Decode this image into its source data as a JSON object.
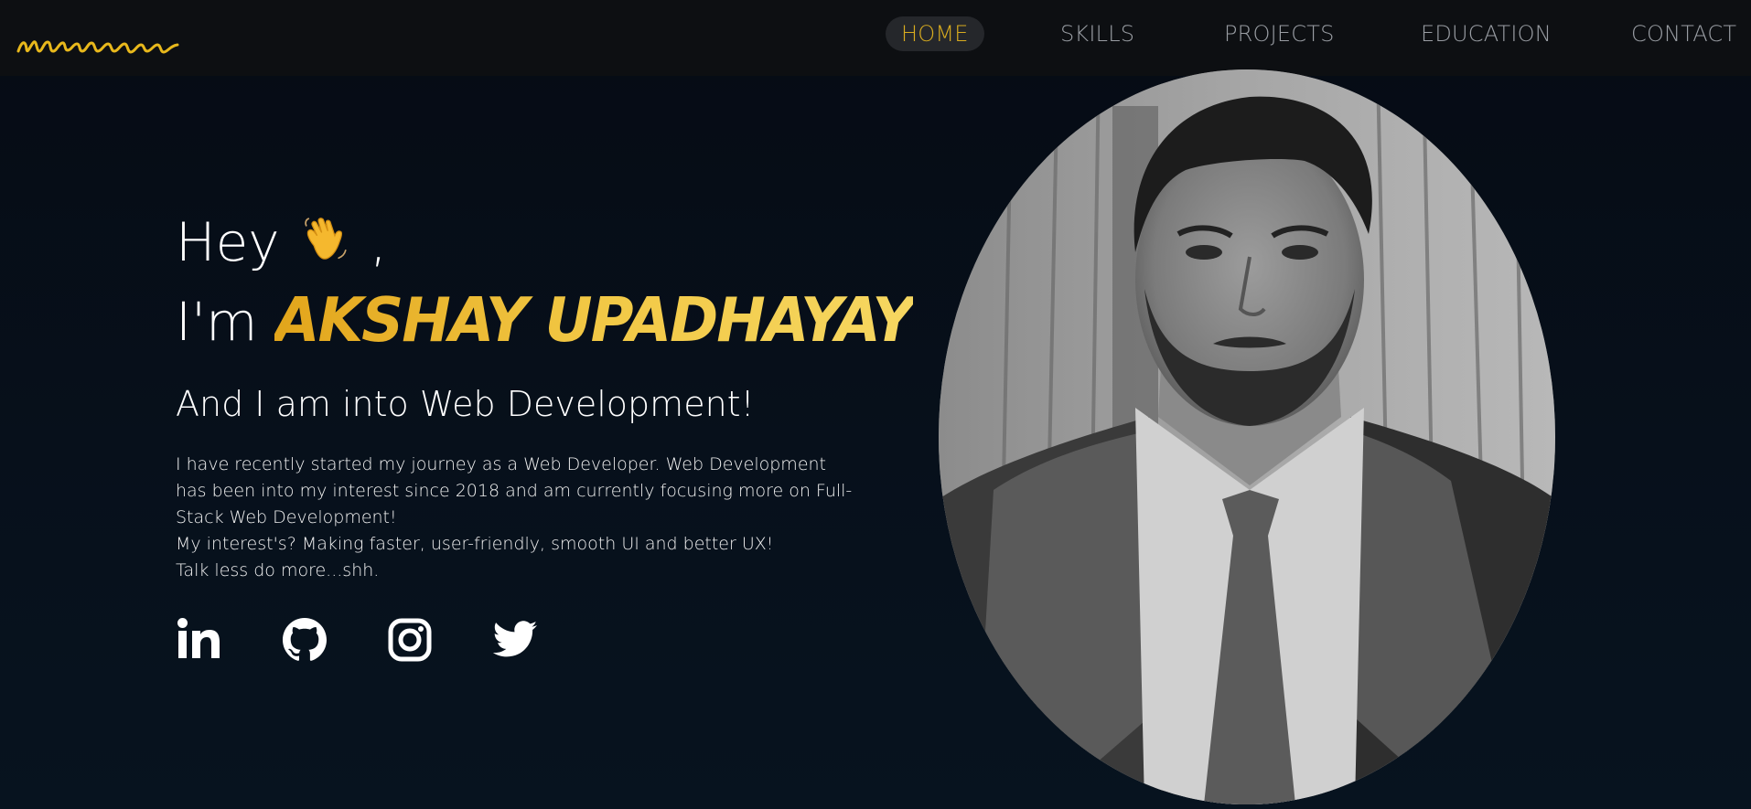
{
  "nav": {
    "items": [
      {
        "label": "HOME",
        "active": true
      },
      {
        "label": "SKILLS",
        "active": false
      },
      {
        "label": "PROJECTS",
        "active": false
      },
      {
        "label": "EDUCATION",
        "active": false
      },
      {
        "label": "CONTACT",
        "active": false
      }
    ]
  },
  "hero": {
    "greeting": "Hey",
    "greeting_suffix": ",",
    "im": "I'm",
    "name": "AKSHAY UPADHAYAY",
    "subtitle": "And I am into Web Development!",
    "about_lines": [
      "I have recently started my journey as a Web Developer. Web Development has been into my interest since 2018 and am currently focusing more on Full-Stack Web Development!",
      "My interest's? Making faster, user-friendly, smooth UI and better UX!",
      "Talk less do more...shh."
    ]
  },
  "socials": [
    {
      "icon": "linkedin-icon"
    },
    {
      "icon": "github-icon"
    },
    {
      "icon": "instagram-icon"
    },
    {
      "icon": "twitter-icon"
    }
  ],
  "colors": {
    "accent": "#d9ac1f",
    "name_gradient_start": "#e2a51b",
    "name_gradient_end": "#f6d761",
    "nav_bg": "#0d0f12",
    "page_bg": "#07101b"
  }
}
